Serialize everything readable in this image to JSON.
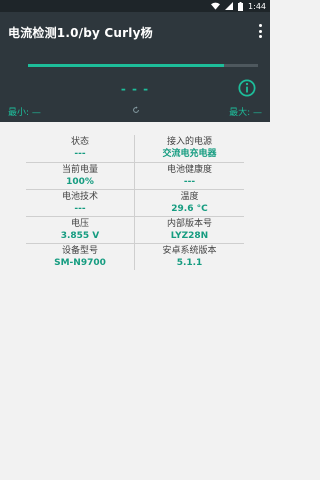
{
  "status_bar": {
    "time": "1:44",
    "icons": [
      "wifi-icon",
      "signal-icon",
      "battery-icon"
    ]
  },
  "app_bar": {
    "title": "电流检测1.0/by Curly杨",
    "overflow_icon": "overflow-menu-icon"
  },
  "hero": {
    "progress_percent": 85,
    "current_value": "- - -",
    "min_label": "最小: —",
    "max_label": "最大: —",
    "info_icon": "info-icon",
    "refresh_icon": "refresh-icon"
  },
  "info_grid": [
    {
      "left": {
        "label": "状态",
        "value": "---"
      },
      "right": {
        "label": "接入的电源",
        "value": "交流电充电器"
      }
    },
    {
      "left": {
        "label": "当前电量",
        "value": "100%"
      },
      "right": {
        "label": "电池健康度",
        "value": "---"
      }
    },
    {
      "left": {
        "label": "电池技术",
        "value": "---"
      },
      "right": {
        "label": "温度",
        "value": "29.6 °C"
      }
    },
    {
      "left": {
        "label": "电压",
        "value": "3.855 V"
      },
      "right": {
        "label": "内部版本号",
        "value": "LYZ28N"
      }
    },
    {
      "left": {
        "label": "设备型号",
        "value": "SM-N9700"
      },
      "right": {
        "label": "安卓系统版本",
        "value": "5.1.1"
      }
    }
  ],
  "colors": {
    "accent": "#1dbd9a",
    "appbar": "#2e373d",
    "statusbar": "#1e2529",
    "background": "#f2f2f2"
  }
}
